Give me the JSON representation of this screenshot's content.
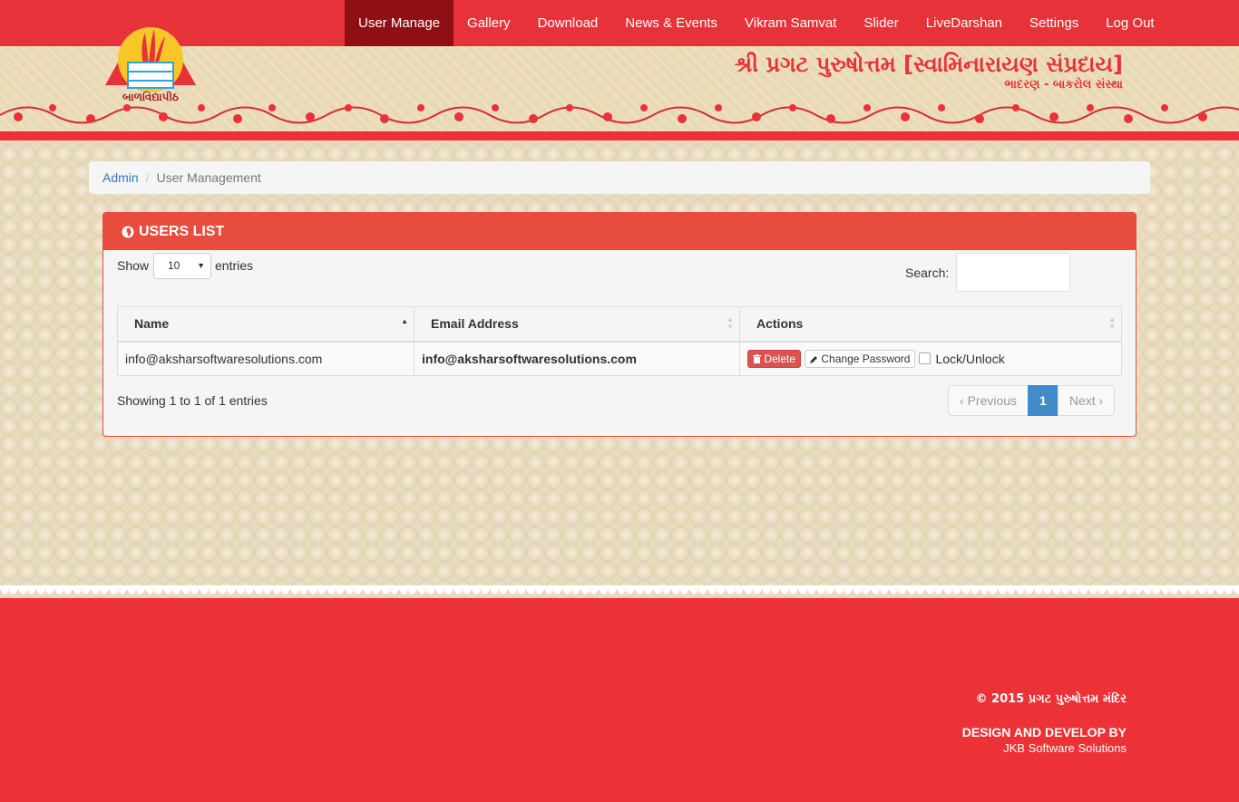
{
  "nav": {
    "items": [
      {
        "label": "User Manage",
        "active": true
      },
      {
        "label": "Gallery"
      },
      {
        "label": "Download"
      },
      {
        "label": "News & Events"
      },
      {
        "label": "Vikram Samvat"
      },
      {
        "label": "Slider"
      },
      {
        "label": "LiveDarshan"
      },
      {
        "label": "Settings"
      },
      {
        "label": "Log Out"
      }
    ]
  },
  "header": {
    "title": "શ્રી પ્રગટ પુરુષોત્તમ [સ્વામિનારાયણ સંપ્રદાય]",
    "subtitle": "ભાદરણ - બાકરોલ સંસ્થા",
    "logo_text": "બાળવિદ્યાપીઠ"
  },
  "breadcrumb": {
    "root": "Admin",
    "current": "User Management"
  },
  "panel": {
    "title": "USERS LIST",
    "show_label": "Show",
    "page_size": "10",
    "entries_label": "entries",
    "search_label": "Search:",
    "columns": [
      "Name",
      "Email Address",
      "Actions"
    ],
    "rows": [
      {
        "name": "info@aksharsoftwaresolutions.com",
        "email": "info@aksharsoftwaresolutions.com",
        "delete": "Delete",
        "change_password": "Change Password",
        "lock": "Lock/Unlock"
      }
    ],
    "info": "Showing 1 to 1 of 1 entries",
    "pager": {
      "prev": "Previous",
      "page": "1",
      "next": "Next"
    }
  },
  "footer": {
    "copyright": "© 2015 પ્રગટ પુરુષોત્તમ મંદિર",
    "design_label": "DESIGN AND DEVELOP BY",
    "developer": "JKB Software Solutions"
  },
  "colors": {
    "brand_red": "#e8323a",
    "nav_active": "#8e1015",
    "panel_red": "#e74c3c",
    "page_active": "#428bca"
  }
}
